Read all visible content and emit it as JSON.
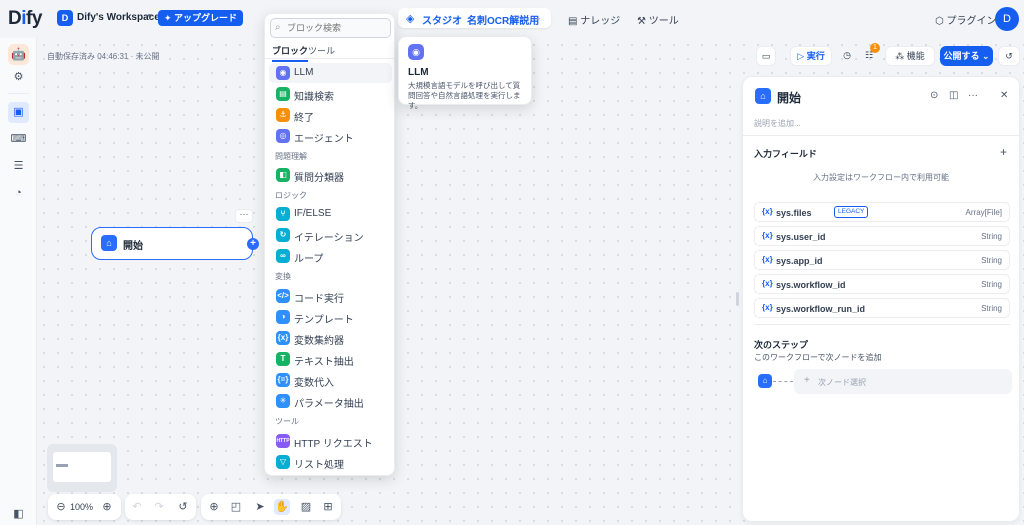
{
  "header": {
    "logo": "Dify",
    "workspace_initial": "D",
    "workspace_name": "Dify's Workspace",
    "upgrade_label": "アップグレード",
    "studio_label": "スタジオ",
    "app_name": "名刺OCR解説用",
    "knowledge_label": "ナレッジ",
    "tools_label": "ツール",
    "plugins_label": "プラグイン",
    "user_initial": "D"
  },
  "canvas": {
    "autosave": "自動保存済み 04:46:31 · 未公開",
    "start_node_label": "開始",
    "zoom": "100%"
  },
  "toolbar": {
    "run_label": "▷ 実行",
    "features_label": "機能",
    "publish_label": "公開する ⌄",
    "checklist_badge": "1"
  },
  "picker": {
    "search_placeholder": "ブロック検索",
    "tabs": [
      "ブロック",
      "ツール"
    ],
    "sections": [
      "問題理解",
      "ロジック",
      "変換",
      "ツール"
    ],
    "items": [
      "LLM",
      "知識検索",
      "終了",
      "エージェント",
      "質問分類器",
      "IF/ELSE",
      "イテレーション",
      "ループ",
      "コード実行",
      "テンプレート",
      "変数集約器",
      "テキスト抽出",
      "変数代入",
      "パラメータ抽出",
      "HTTP リクエスト",
      "リスト処理"
    ]
  },
  "tooltip": {
    "title": "LLM",
    "description": "大規模言語モデルを呼び出して質問回答や自然言語処理を実行します。"
  },
  "panel": {
    "title": "開始",
    "description_placeholder": "説明を追加...",
    "input_fields_label": "入力フィールド",
    "input_empty": "入力設定はワークフロー内で利用可能",
    "legacy_tag": "LEGACY",
    "variables": [
      {
        "name": "sys.files",
        "type": "Array[File]"
      },
      {
        "name": "sys.user_id",
        "type": "String"
      },
      {
        "name": "sys.app_id",
        "type": "String"
      },
      {
        "name": "sys.workflow_id",
        "type": "String"
      },
      {
        "name": "sys.workflow_run_id",
        "type": "String"
      }
    ],
    "next_step_label": "次のステップ",
    "next_step_sub": "このワークフローで次ノードを追加",
    "next_select_label": "次ノード選択"
  },
  "colors": {
    "accent": "#155eef",
    "node_blue": "#296dff",
    "badge": "#f79009"
  }
}
